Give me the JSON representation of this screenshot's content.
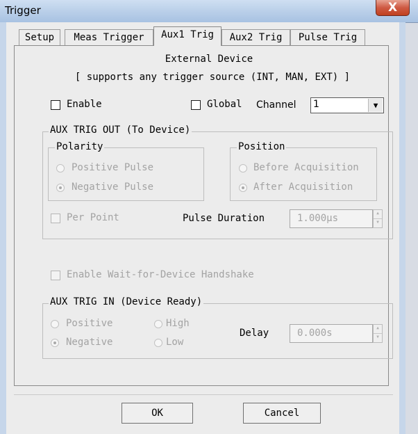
{
  "window": {
    "title": "Trigger",
    "close_glyph": "X"
  },
  "tabs": [
    {
      "label": "Setup"
    },
    {
      "label": "Meas Trigger"
    },
    {
      "label": "Aux1 Trig"
    },
    {
      "label": "Aux2 Trig"
    },
    {
      "label": "Pulse Trig"
    }
  ],
  "active_tab": "Aux1 Trig",
  "header": {
    "line1": "External Device",
    "line2": "[ supports any trigger source (INT, MAN, EXT) ]"
  },
  "enable": {
    "label": "Enable",
    "checked": false
  },
  "global": {
    "label": "Global",
    "checked": false
  },
  "channel": {
    "label": "Channel",
    "value": "1"
  },
  "aux_out": {
    "title": "AUX TRIG OUT (To Device)",
    "polarity": {
      "title": "Polarity",
      "options": [
        "Positive Pulse",
        "Negative Pulse"
      ],
      "selected": "Negative Pulse"
    },
    "position": {
      "title": "Position",
      "options": [
        "Before Acquisition",
        "After Acquisition"
      ],
      "selected": "After Acquisition"
    },
    "per_point": {
      "label": "Per Point",
      "checked": false
    },
    "pulse_duration": {
      "label": "Pulse Duration",
      "value": "1.000μs"
    }
  },
  "handshake": {
    "label": "Enable Wait-for-Device Handshake",
    "checked": false
  },
  "aux_in": {
    "title": "AUX TRIG IN (Device Ready)",
    "polarity_options": [
      "Positive",
      "Negative"
    ],
    "polarity_selected": "Negative",
    "level_options": [
      "High",
      "Low"
    ],
    "delay": {
      "label": "Delay",
      "value": "0.000s"
    }
  },
  "buttons": {
    "ok": "OK",
    "cancel": "Cancel"
  },
  "colors": {
    "disabled_text": "#a3a3a3",
    "title_bar": "#bcd1ea",
    "close_button": "#c84b31"
  }
}
